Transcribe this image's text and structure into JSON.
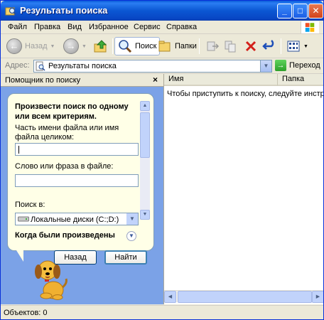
{
  "window": {
    "title": "Результаты поиска",
    "controls": {
      "minimize": "_",
      "maximize": "□",
      "close": "✕"
    }
  },
  "menu": [
    "Файл",
    "Правка",
    "Вид",
    "Избранное",
    "Сервис",
    "Справка"
  ],
  "toolbar": {
    "back_label": "Назад",
    "search_label": "Поиск",
    "folders_label": "Папки"
  },
  "address": {
    "label": "Адрес:",
    "value": "Результаты поиска",
    "go_label": "Переход"
  },
  "search_pane": {
    "title": "Помощник по поиску",
    "close_glyph": "×",
    "heading": "Произвести поиск по одному или всем критериям.",
    "filename_label": "Часть имени файла или имя файла целиком:",
    "filename_value": "",
    "phrase_label": "Слово или фраза в файле:",
    "phrase_value": "",
    "lookin_label": "Поиск в:",
    "lookin_value": "Локальные диски (C:;D:)",
    "when_label": "Когда были произведены",
    "back_button": "Назад",
    "search_button": "Найти"
  },
  "results": {
    "columns": [
      "Имя",
      "Папка"
    ],
    "empty_message": "Чтобы приступить к поиску, следуйте инструкц"
  },
  "status": {
    "text": "Объектов: 0"
  },
  "colors": {
    "titlebar": "#0b57d3",
    "pane_background": "#7ba2e7",
    "bubble": "#ffffe7",
    "chrome": "#ece9d8"
  }
}
